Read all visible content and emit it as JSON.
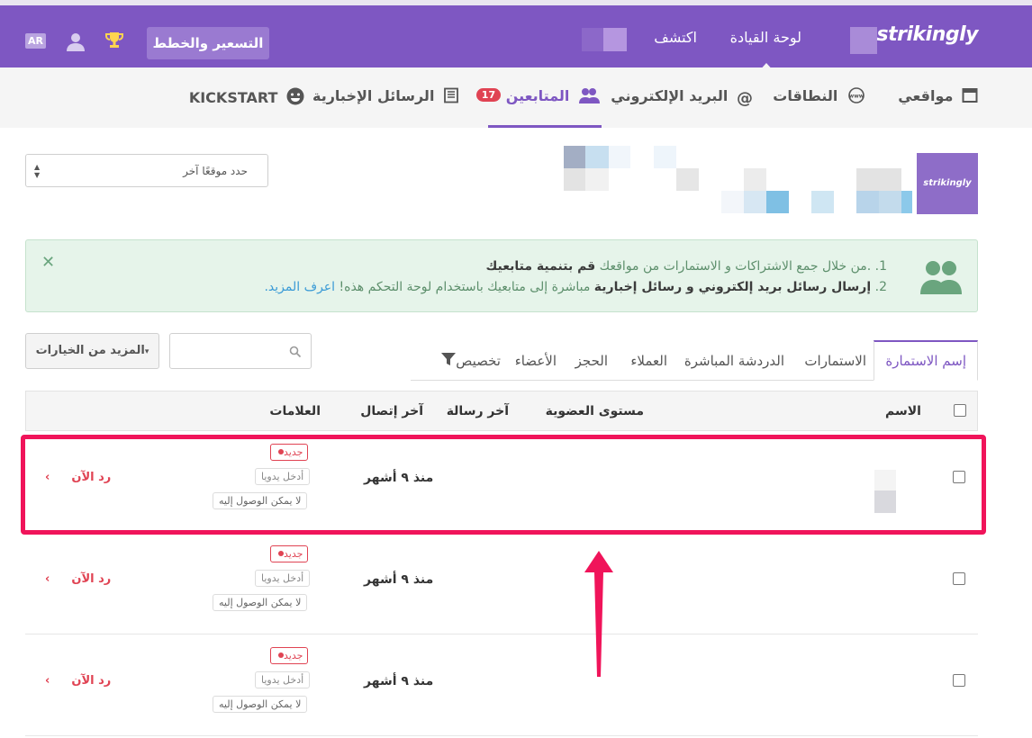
{
  "topbar": {
    "logo": "strikingly",
    "dashboard": "لوحة القيادة",
    "explore": "اكتشف",
    "pricing": "التسعير والخطط",
    "lang": "AR",
    "icons": [
      "trophy-icon",
      "user-icon"
    ]
  },
  "subnav": {
    "sites": "مواقعي",
    "domains": "النطاقات",
    "email": "البريد الإلكتروني",
    "followers": "المتابعين",
    "followers_count": "17",
    "newsletters": "الرسائل الإخبارية",
    "kickstart": "KICKSTART"
  },
  "site_select": {
    "placeholder": "حدد موقعًا آخر"
  },
  "site_thumb": "strikingly",
  "notice": {
    "line1_prefix": "1. .من خلال جمع الاشتراكات و الاستمارات من مواقعك ",
    "line1_bold": "قم بتنمية متابعيك",
    "line2_prefix": "2. ",
    "line2_bold": "إرسال رسائل بريد إلكتروني و رسائل إخبارية",
    "line2_text": " مباشرة إلى متابعيك باستخدام لوحة التحكم هذه! ",
    "line2_link": "اعرف المزيد."
  },
  "filters": {
    "more": "المزيد من الخيارات",
    "tabs": [
      "إسم الاستمارة",
      "الاستمارات",
      "الدردشة المباشرة",
      "العملاء",
      "الحجز",
      "الأعضاء",
      "تخصيص"
    ]
  },
  "table": {
    "headers": {
      "name": "الاسم",
      "membership": "مستوى العضوية",
      "last_message": "آخر رسالة",
      "last_contact": "آخر إتصال",
      "tags": "العلامات"
    },
    "rows": [
      {
        "tag_new": "جديد",
        "tag_manual": "أدخل يدويا",
        "tag_unreachable": "لا يمكن الوصول إليه",
        "last_contact": "منذ ٩ أشهر",
        "reply": "رد الآن"
      },
      {
        "tag_new": "جديد",
        "tag_manual": "أدخل يدويا",
        "tag_unreachable": "لا يمكن الوصول إليه",
        "last_contact": "منذ ٩ أشهر",
        "reply": "رد الآن"
      },
      {
        "tag_new": "جديد",
        "tag_manual": "أدخل يدويا",
        "tag_unreachable": "لا يمكن الوصول إليه",
        "last_contact": "منذ ٩ أشهر",
        "reply": "رد الآن"
      }
    ]
  },
  "colors": {
    "brand": "#7e57c2",
    "alert": "#e04353",
    "highlight": "#f0145a"
  }
}
